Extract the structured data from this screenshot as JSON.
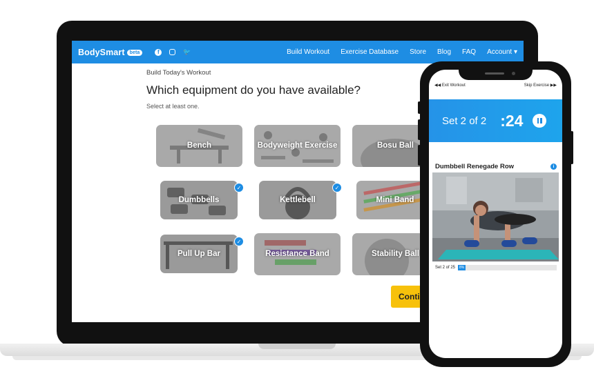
{
  "laptop": {
    "navbar": {
      "brand": "BodySmart",
      "beta": "beta",
      "social": [
        "facebook-icon",
        "instagram-icon",
        "twitter-icon"
      ],
      "links": [
        "Build Workout",
        "Exercise Database",
        "Store",
        "Blog",
        "FAQ",
        "Account ▾"
      ]
    },
    "breadcrumb": "Build Today's Workout",
    "headline": "Which equipment do you have available?",
    "hint": "Select at least one.",
    "tiles": [
      {
        "label": "Bench",
        "selected": false
      },
      {
        "label": "Bodyweight Exercise",
        "selected": false
      },
      {
        "label": "Bosu Ball",
        "selected": false
      },
      {
        "label": "Dumbbells",
        "selected": true
      },
      {
        "label": "Kettlebell",
        "selected": true
      },
      {
        "label": "Mini Band",
        "selected": false
      },
      {
        "label": "Pull Up Bar",
        "selected": true
      },
      {
        "label": "Resistance Band",
        "selected": false
      },
      {
        "label": "Stability Ball",
        "selected": false
      }
    ],
    "continue_label": "Conti"
  },
  "phone": {
    "exit_label": "◀◀ Exit Workout",
    "skip_label": "Skip Exercise ▶▶",
    "set_label": "Set 2 of 2",
    "timer": ":24",
    "exercise_title": "Dumbbell Renegade Row",
    "progress_label": "Set 2 of 25",
    "progress_value": "8%",
    "progress_fraction": 0.08
  },
  "colors": {
    "primary": "#1e8de3",
    "accent": "#f7c10b"
  }
}
